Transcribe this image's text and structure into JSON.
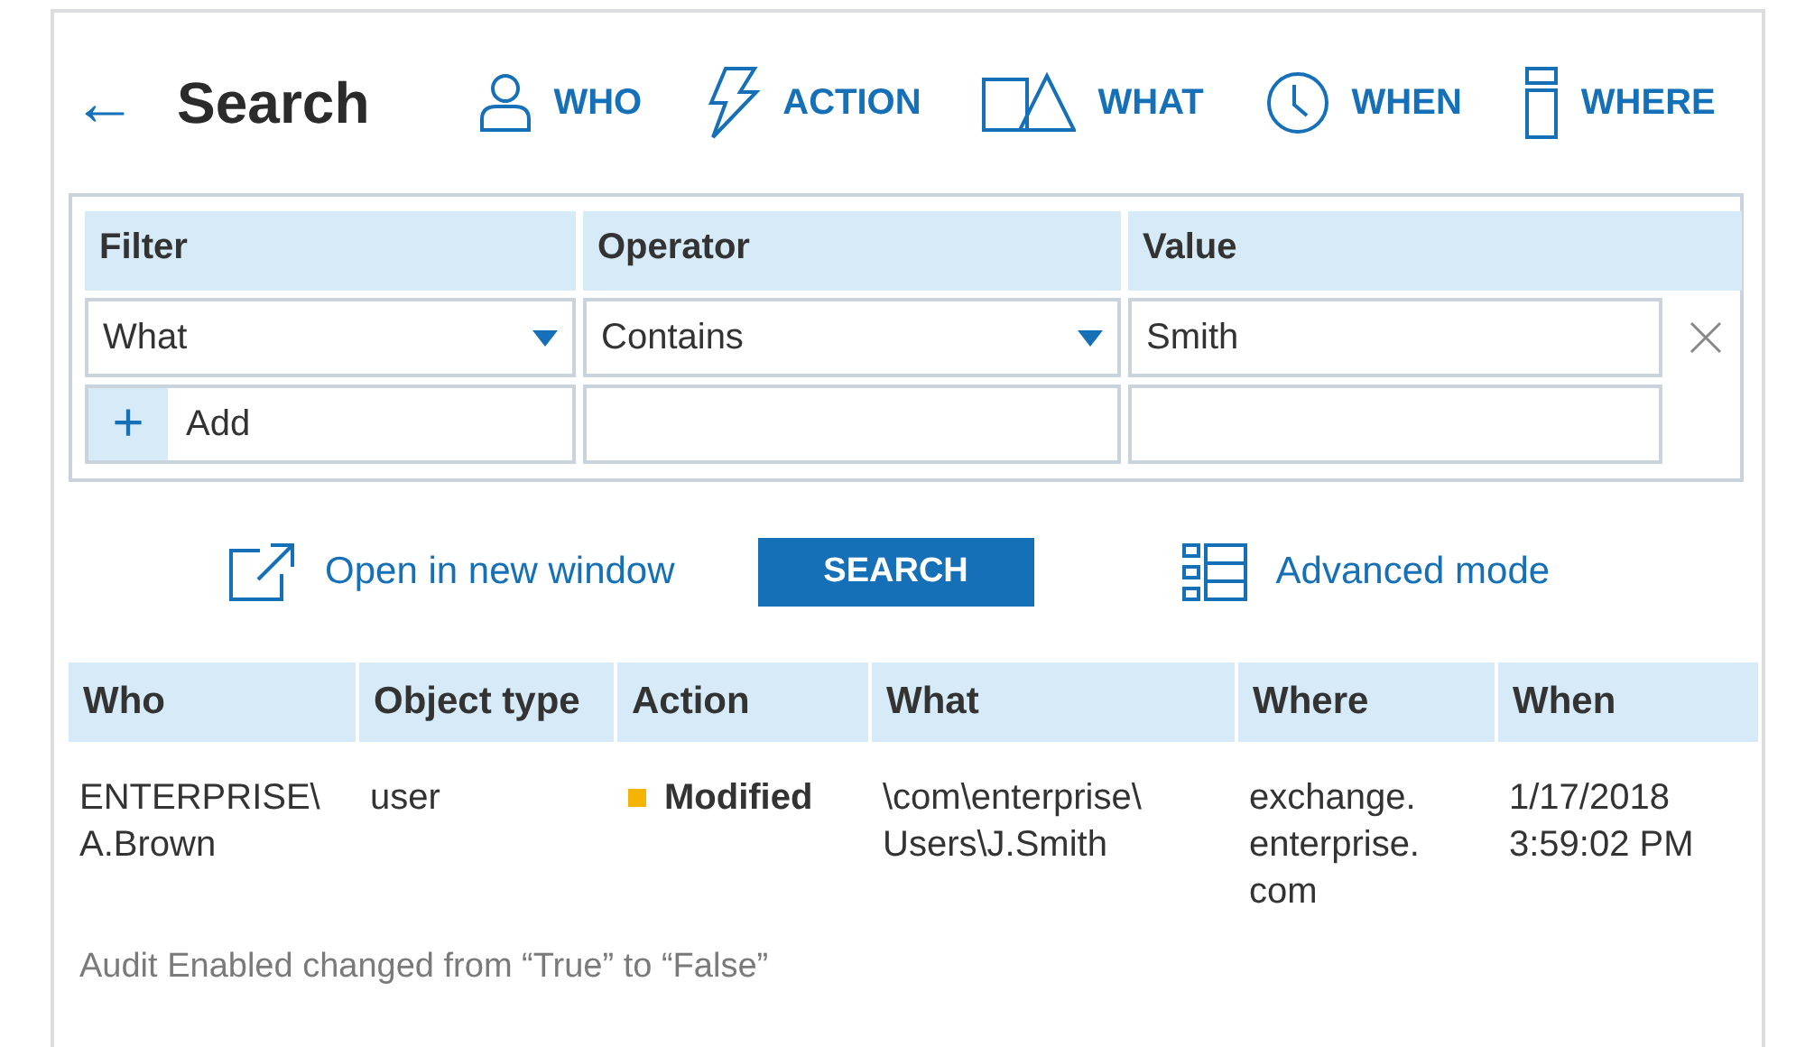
{
  "header": {
    "back": "←",
    "title": "Search",
    "nav": [
      {
        "label": "WHO",
        "kind": "person"
      },
      {
        "label": "ACTION",
        "kind": "bolt"
      },
      {
        "label": "WHAT",
        "kind": "shapes"
      },
      {
        "label": "WHEN",
        "kind": "clock"
      },
      {
        "label": "WHERE",
        "kind": "server"
      }
    ]
  },
  "filters": {
    "columns": [
      "Filter",
      "Operator",
      "Value"
    ],
    "rows": [
      {
        "filter": "What",
        "operator": "Contains",
        "value": "Smith"
      }
    ],
    "add": {
      "icon": "+",
      "label": "Add"
    }
  },
  "actions": {
    "open_link": "Open in new window",
    "search_button": "SEARCH",
    "advanced_link": "Advanced mode"
  },
  "results": {
    "columns": [
      "Who",
      "Object type",
      "Action",
      "What",
      "Where",
      "When"
    ],
    "rows": [
      {
        "who": [
          "ENTERPRISE\\",
          "A.Brown"
        ],
        "object_type": [
          "user"
        ],
        "action": "Modified",
        "color": "#f5b400",
        "what": [
          "\\com\\enterprise\\",
          "Users\\J.Smith"
        ],
        "where": [
          "exchange.",
          "enterprise.",
          "com"
        ],
        "when": [
          "1/17/2018",
          "3:59:02 PM"
        ],
        "detail": "Audit Enabled changed from “True” to “False”"
      }
    ]
  }
}
